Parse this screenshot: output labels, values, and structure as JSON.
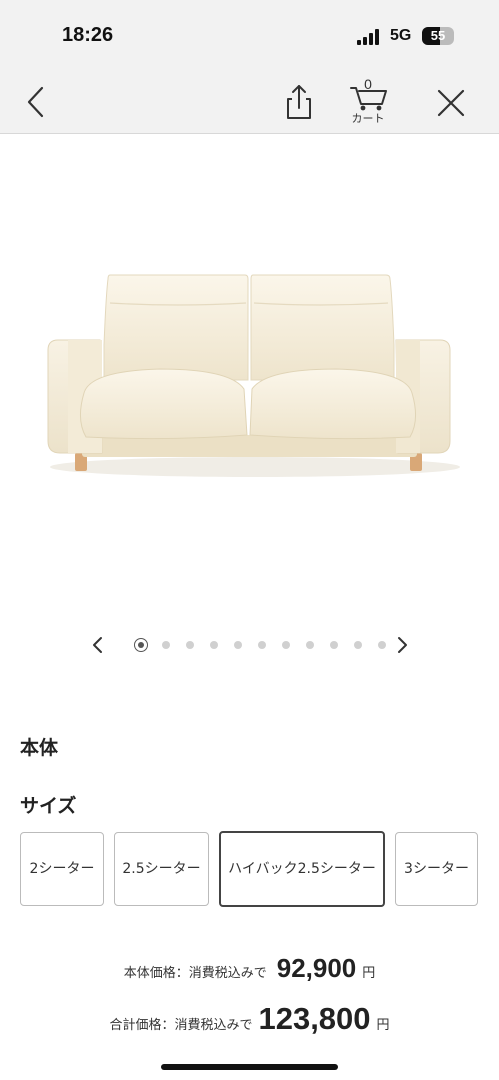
{
  "status_bar": {
    "time": "18:26",
    "network": "5G",
    "battery_level": "55",
    "battery_fraction": 0.55
  },
  "nav": {
    "back_icon": "chevron-left-icon",
    "share_icon": "share-icon",
    "cart_icon": "cart-icon",
    "cart_count": "0",
    "cart_label": "カート",
    "close_icon": "close-icon"
  },
  "product": {
    "image_subject": "sofa-photo"
  },
  "carousel": {
    "total_slides": 11,
    "active_index": 0
  },
  "sections": {
    "body_title": "本体",
    "size_title": "サイズ"
  },
  "size_options": [
    {
      "label": "2シーター",
      "selected": false
    },
    {
      "label": "2.5シーター",
      "selected": false
    },
    {
      "label": "ハイバック2.5シーター",
      "selected": true
    },
    {
      "label": "3シーター",
      "selected": false
    }
  ],
  "prices": {
    "body_label": "本体価格：消費税込みで",
    "body_value": "92,900",
    "total_label": "合計価格：消費税込みで",
    "total_value": "123,800",
    "unit": "円"
  },
  "colors": {
    "chrome_bg": "#f2f2f2",
    "text_dark": "#222222",
    "selected_border": "#444444",
    "sofa_fabric": "#f3ead6",
    "sofa_legs": "#d9a877"
  }
}
